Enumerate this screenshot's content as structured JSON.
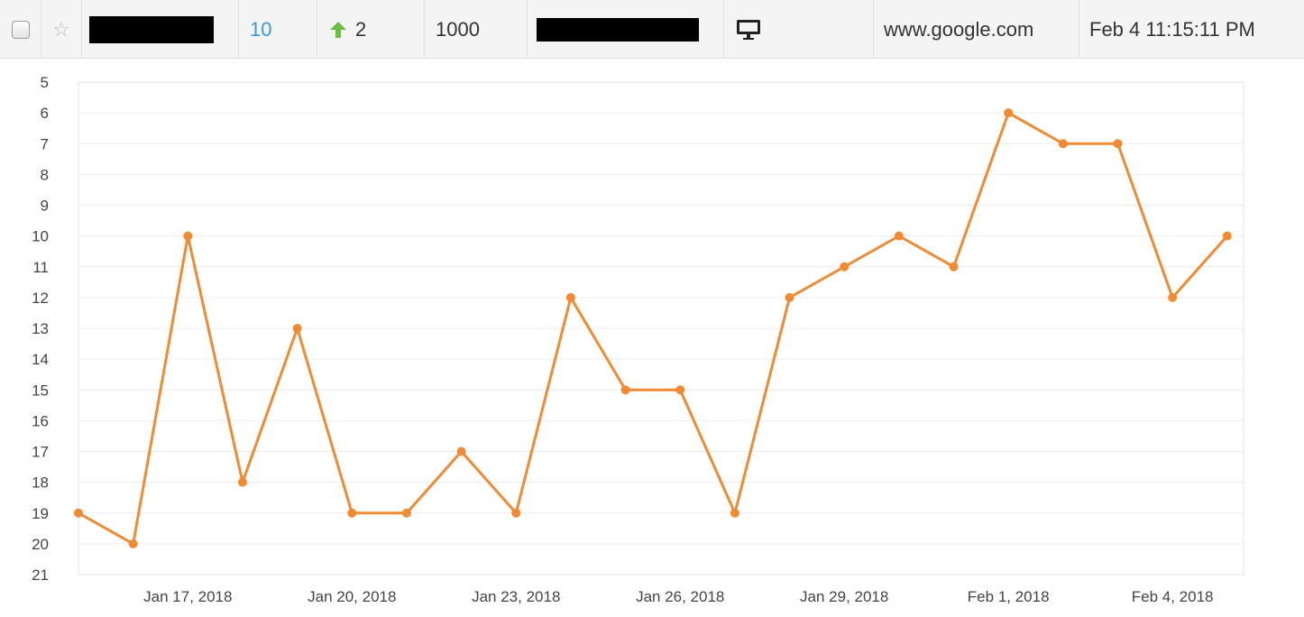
{
  "row": {
    "rank": "10",
    "change": "2",
    "volume": "1000",
    "device_icon": "desktop-monitor-icon",
    "domain": "www.google.com",
    "updated": "Feb 4 11:15:11 PM"
  },
  "colors": {
    "line": "#f08a33",
    "rank_link": "#3a9ad9",
    "up_arrow": "#6abf40"
  },
  "chart_data": {
    "type": "line",
    "title": "",
    "xlabel": "",
    "ylabel": "",
    "y_reversed": true,
    "ylim": [
      5,
      21
    ],
    "grid": true,
    "y_ticks": [
      "5",
      "6",
      "7",
      "8",
      "9",
      "10",
      "11",
      "12",
      "13",
      "14",
      "15",
      "16",
      "17",
      "18",
      "19",
      "20",
      "21"
    ],
    "x_ticks": [
      "Jan 17, 2018",
      "Jan 20, 2018",
      "Jan 23, 2018",
      "Jan 26, 2018",
      "Jan 29, 2018",
      "Feb 1, 2018",
      "Feb 4, 2018"
    ],
    "series": [
      {
        "x": [
          "2018-01-15",
          "2018-01-16",
          "2018-01-17",
          "2018-01-18",
          "2018-01-19",
          "2018-01-20",
          "2018-01-21",
          "2018-01-22",
          "2018-01-23",
          "2018-01-24",
          "2018-01-25",
          "2018-01-26",
          "2018-01-27",
          "2018-01-28",
          "2018-01-29",
          "2018-01-30",
          "2018-01-31",
          "2018-02-01",
          "2018-02-02",
          "2018-02-03",
          "2018-02-04",
          "2018-02-05"
        ],
        "values": [
          19,
          20,
          10,
          18,
          13,
          19,
          19,
          17,
          19,
          12,
          15,
          15,
          19,
          12,
          11,
          10,
          11,
          6,
          7,
          7,
          12,
          10
        ]
      }
    ]
  }
}
